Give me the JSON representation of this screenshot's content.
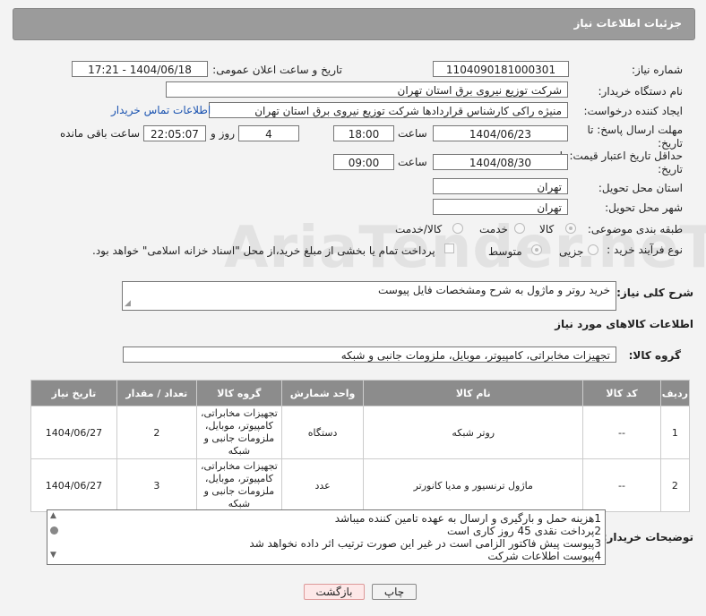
{
  "header": {
    "title": "جزئیات اطلاعات نیاز"
  },
  "watermark": "AriaTender.neT",
  "labels": {
    "need_number": "شماره نیاز:",
    "announce": "تاریخ و ساعت اعلان عمومی:",
    "buyer_org": "نام دستگاه خریدار:",
    "requester": "ایجاد کننده درخواست:",
    "deadline": "مهلت ارسال پاسخ: تا تاریخ:",
    "price_validity": "حداقل تاریخ اعتبار قیمت: تا تاریخ:",
    "province": "استان محل تحویل:",
    "city": "شهر محل تحویل:",
    "category": "طبقه بندی موضوعی:",
    "process": "نوع فرآیند خرید :",
    "time": "ساعت",
    "day_and": "روز و",
    "remaining": "ساعت باقی مانده",
    "description": "شرح کلی نیاز:",
    "goods_info": "اطلاعات کالاهای مورد نیاز",
    "goods_group": "گروه کالا:",
    "buyer_notes": "توضیحات خریدار:"
  },
  "fields": {
    "need_number": "1104090181000301",
    "announce": "1404/06/18 - 17:21",
    "buyer_org": "شرکت توزیع نیروی برق استان تهران",
    "requester": "منیژه راکی کارشناس قراردادها شرکت توزیع نیروی برق استان تهران",
    "contact_link": "اطلاعات تماس خریدار",
    "deadline_date": "1404/06/23",
    "deadline_time": "18:00",
    "days": "4",
    "remaining_time": "22:05:07",
    "validity_date": "1404/08/30",
    "validity_time": "09:00",
    "province": "تهران",
    "city": "تهران",
    "description": "خرید روتر و ماژول به شرح ومشخصات فایل پیوست",
    "goods_group": "تجهیزات مخابراتی، کامپیوتر، موبایل، ملزومات جانبی و شبکه"
  },
  "category_options": [
    {
      "label": "کالا",
      "selected": true
    },
    {
      "label": "خدمت",
      "selected": false
    },
    {
      "label": "کالا/خدمت",
      "selected": false
    }
  ],
  "process_options": [
    {
      "label": "جزیی",
      "selected": false
    },
    {
      "label": "متوسط",
      "selected": true
    }
  ],
  "payment_note": "پرداخت تمام یا بخشی از مبلغ خرید،از محل \"اسناد خزانه اسلامی\" خواهد بود.",
  "table": {
    "headers": [
      "ردیف",
      "کد کالا",
      "نام کالا",
      "واحد شمارش",
      "گروه کالا",
      "تعداد / مقدار",
      "تاریخ نیاز"
    ],
    "rows": [
      {
        "idx": "1",
        "code": "--",
        "name": "روتر شبکه",
        "unit": "دستگاه",
        "group": "تجهیزات مخابراتی، کامپیوتر، موبایل، ملزومات جانبی و شبکه",
        "qty": "2",
        "date": "1404/06/27"
      },
      {
        "idx": "2",
        "code": "--",
        "name": "ماژول ترنسیور و مدیا کانورتر",
        "unit": "عدد",
        "group": "تجهیزات مخابراتی، کامپیوتر، موبایل، ملزومات جانبی و شبکه",
        "qty": "3",
        "date": "1404/06/27"
      }
    ]
  },
  "notes": [
    "1هزینه حمل و بارگیری و ارسال به عهده تامین کننده میباشد",
    "2پرداخت نقدی 45 روز کاری است",
    "3پیوست پیش فاکتور الزامی است در غیر این صورت ترتیب اثر داده نخواهد شد",
    "4پیوست اطلاعات شرکت"
  ],
  "buttons": {
    "print": "چاپ",
    "back": "بازگشت"
  }
}
